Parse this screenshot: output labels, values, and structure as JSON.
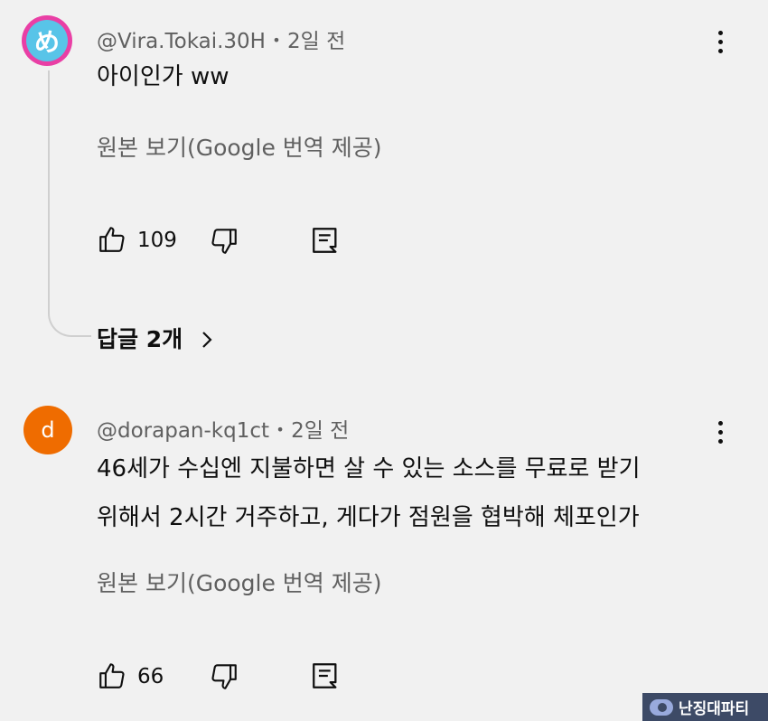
{
  "comments": [
    {
      "avatar_glyph": "め",
      "author": "@Vira.Tokai.30H",
      "time": "2일 전",
      "text_lines": [
        "아이인가 ww"
      ],
      "translate": "원본 보기(Google 번역 제공)",
      "likes": "109",
      "replies": "답글 2개"
    },
    {
      "avatar_glyph": "d",
      "author": "@dorapan-kq1ct",
      "time": "2일 전",
      "text_lines": [
        "46세가 수십엔 지불하면 살 수 있는 소스를 무료로 받기",
        "위해서 2시간 거주하고, 게다가 점원을 협박해 체포인가"
      ],
      "translate": "원본 보기(Google 번역 제공)",
      "likes": "66"
    }
  ],
  "separator": "•",
  "watermark": "난징대파티",
  "colors": {
    "background": "#f1f1f1",
    "avatar1": "#e93fa5",
    "avatar2": "#ef6c00"
  }
}
